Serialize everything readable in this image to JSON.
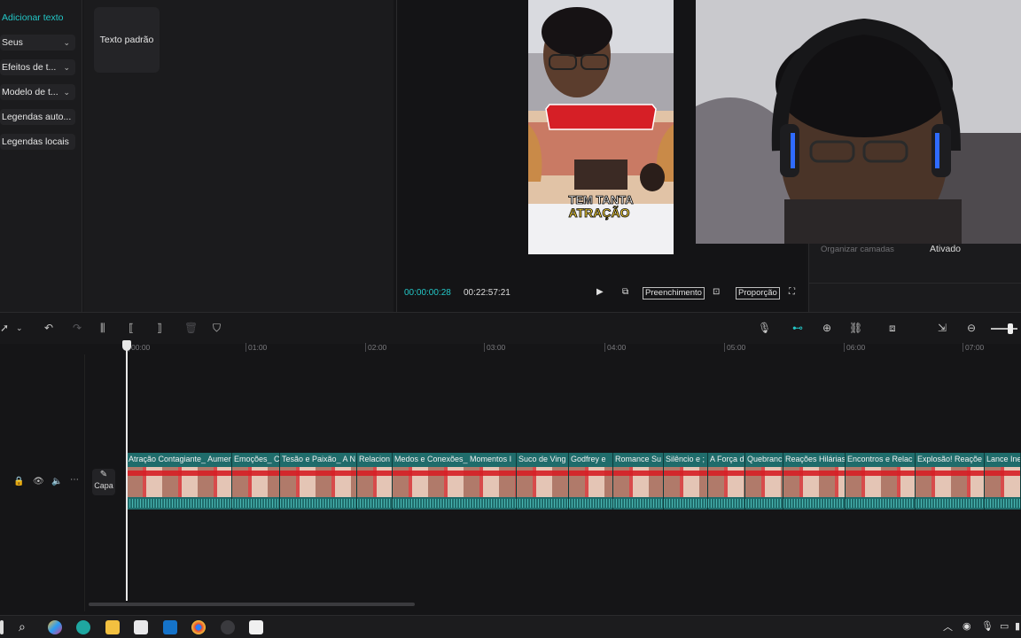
{
  "leftnav": {
    "items": [
      {
        "label": "Adicionar texto",
        "active": true,
        "dropdown": false
      },
      {
        "label": "Seus",
        "dropdown": true
      },
      {
        "label": "Efeitos de t...",
        "dropdown": true
      },
      {
        "label": "Modelo de t...",
        "dropdown": true
      },
      {
        "label": "Legendas auto...",
        "dropdown": false
      },
      {
        "label": "Legendas locais",
        "dropdown": false
      }
    ]
  },
  "content": {
    "preset_label": "Texto padrão"
  },
  "video_overlay_text": {
    "line1": "TEM TANTA",
    "line2": "ATRAÇÃO"
  },
  "properties": {
    "layer_label": "Organizar camadas",
    "layer_value": "Ativado"
  },
  "player": {
    "current_time": "00:00:00:28",
    "total_time": "00:22:57:21",
    "fill_label": "Preenchimento",
    "ratio_label": "Proporção"
  },
  "ruler": {
    "ticks": [
      "00:00",
      "01:00",
      "02:00",
      "03:00",
      "04:00",
      "05:00",
      "06:00",
      "07:00"
    ]
  },
  "track": {
    "cover_label": "Capa"
  },
  "clips": [
    "Atração Contagiante_ Aumer",
    "Emoções_ C",
    "Tesão e Paixão_ A N",
    "Relacion",
    "Medos e Conexões_ Momentos I",
    "Suco de Ving",
    "Godfrey e",
    "Romance Su",
    "Silêncio e ;",
    "A Força d",
    "Quebranc",
    "Reações Hilárias",
    "Encontros e Relac",
    "Explosão! Reaçõe",
    "Lance Ine"
  ],
  "colors": {
    "accent": "#23c7c7",
    "clip": "#1f6c6b",
    "banner": "#d61f26"
  }
}
